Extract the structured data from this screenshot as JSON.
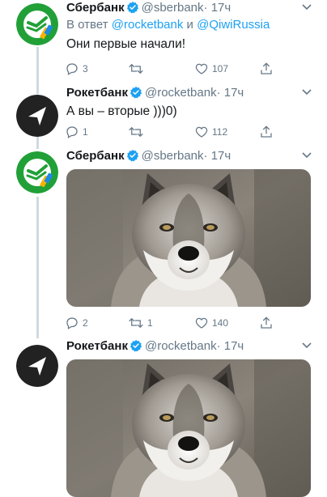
{
  "colors": {
    "accent": "#1da1f2",
    "secondary_text": "#657786",
    "sber_green": "#21a038",
    "rocket_dark": "#222222",
    "thread_line": "#cfd9de"
  },
  "tweets": [
    {
      "name": "Сбербанк",
      "handle": "@sberbank",
      "time": "· 17ч",
      "avatar_icon": "sberbank-logo",
      "reply_prefix": "В ответ",
      "reply_mention_1": "@rocketbank",
      "reply_and": "и",
      "reply_mention_2": "@QiwiRussia",
      "text": "Они первые начали!",
      "replies": "3",
      "retweets": "",
      "likes": "107"
    },
    {
      "name": "Рокетбанк",
      "handle": "@rocketbank",
      "time": "· 17ч",
      "avatar_icon": "rocketbank-logo",
      "text": "А вы – вторые )))0)",
      "replies": "1",
      "retweets": "",
      "likes": "112"
    },
    {
      "name": "Сбербанк",
      "handle": "@sberbank",
      "time": "· 17ч",
      "avatar_icon": "sberbank-logo",
      "media": "wolf-photo",
      "replies": "2",
      "retweets": "1",
      "likes": "140"
    },
    {
      "name": "Рокетбанк",
      "handle": "@rocketbank",
      "time": "· 17ч",
      "avatar_icon": "rocketbank-logo",
      "media": "wolf-photo"
    }
  ]
}
